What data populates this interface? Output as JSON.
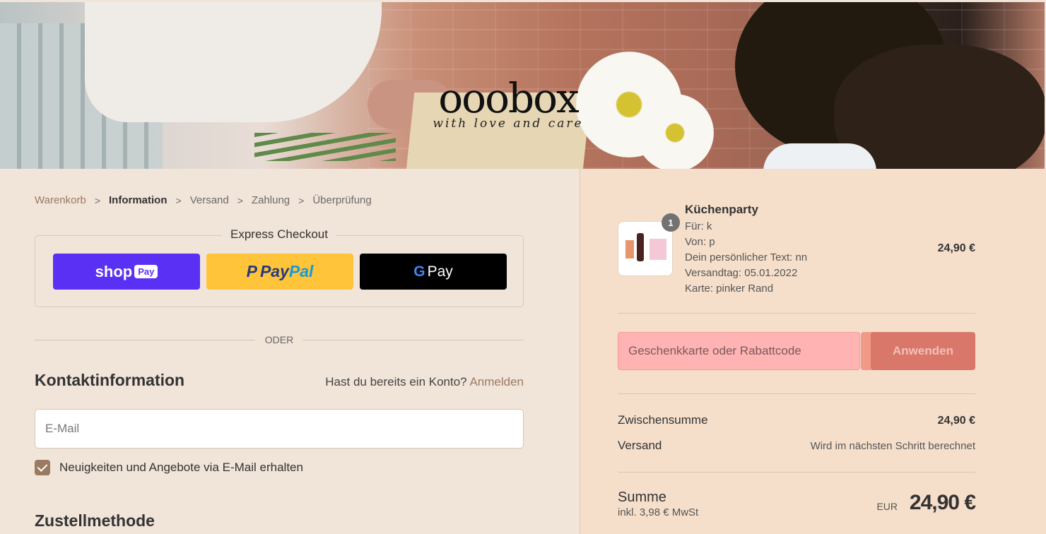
{
  "brand": {
    "name": "ooobox",
    "tagline": "with love and care"
  },
  "breadcrumb": [
    {
      "label": "Warenkorb"
    },
    {
      "label": "Information"
    },
    {
      "label": "Versand"
    },
    {
      "label": "Zahlung"
    },
    {
      "label": "Überprüfung"
    }
  ],
  "express": {
    "title": "Express Checkout",
    "shop_pay": {
      "text": "shop",
      "badge": "Pay"
    },
    "paypal": {
      "text1": "Pay",
      "text2": "Pal"
    },
    "gpay": {
      "g": "G",
      "text": "Pay"
    }
  },
  "divider_text": "ODER",
  "contact": {
    "title": "Kontaktinformation",
    "login_prompt": "Hast du bereits ein Konto?",
    "login_link": "Anmelden",
    "email_placeholder": "E-Mail",
    "newsletter_label": "Neuigkeiten und Angebote via E-Mail erhalten",
    "newsletter_checked": true
  },
  "shipping_title": "Zustellmethode",
  "order": {
    "product": {
      "name": "Küchenparty",
      "quantity": "1",
      "props": [
        "Für: k",
        "Von: p",
        "Dein persönlicher Text: nn",
        "Versandtag: 05.01.2022",
        "Karte: pinker Rand"
      ],
      "price": "24,90 €"
    },
    "discount": {
      "placeholder": "Geschenkkarte oder Rabattcode",
      "button": "Anwenden"
    },
    "subtotal": {
      "label": "Zwischensumme",
      "value": "24,90 €"
    },
    "shipping": {
      "label": "Versand",
      "value": "Wird im nächsten Schritt berechnet"
    },
    "total": {
      "label": "Summe",
      "tax": "inkl. 3,98 € MwSt",
      "currency": "EUR",
      "value": "24,90 €"
    }
  },
  "colors": {
    "accent": "#9b7a62",
    "left_bg": "#f1e4d9",
    "right_bg": "#f5dfca",
    "discount_bg": "#ffb3b3",
    "apply_bg": "#d9776a"
  }
}
